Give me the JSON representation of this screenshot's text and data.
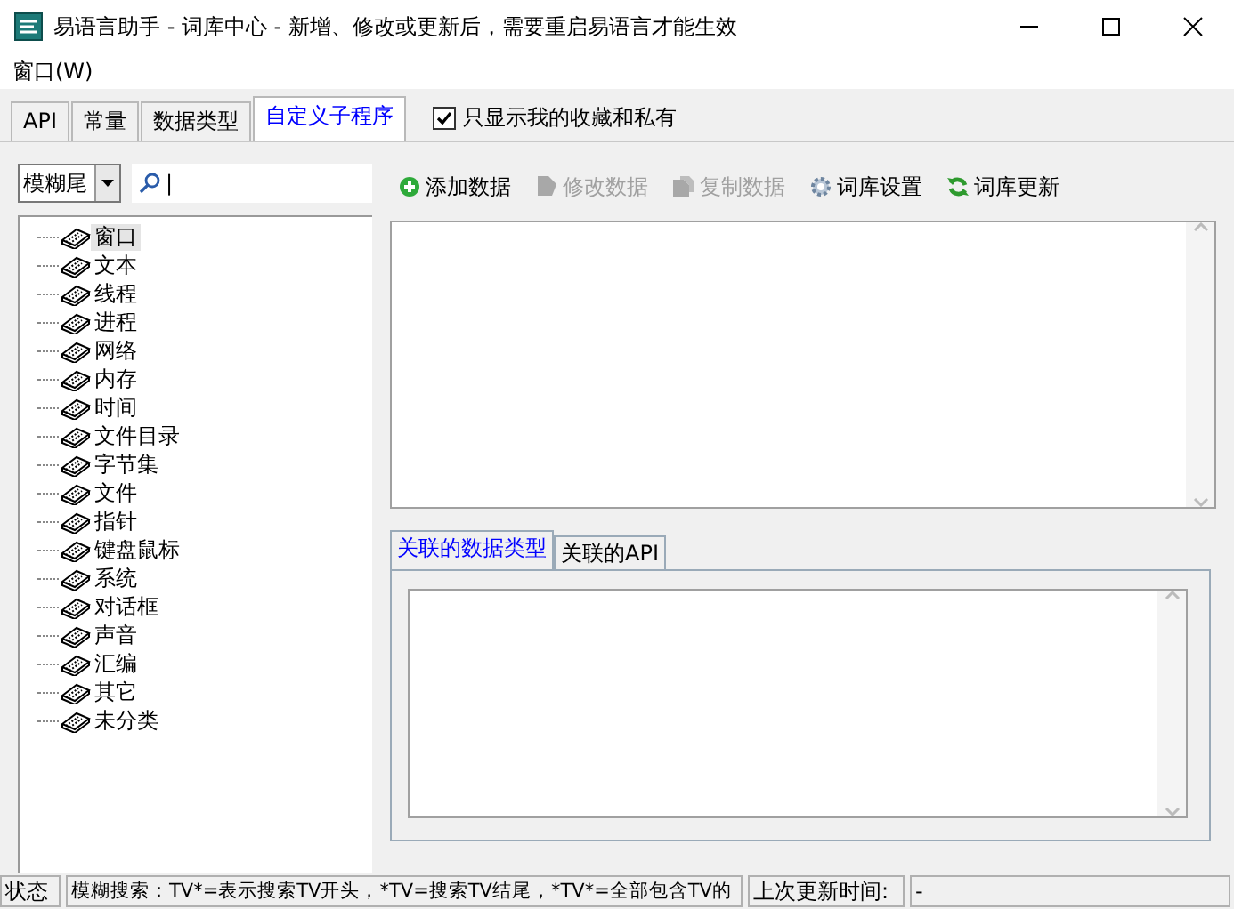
{
  "window": {
    "title": "易语言助手 - 词库中心 - 新增、修改或更新后，需要重启易语言才能生效"
  },
  "menu": [
    "窗口(W)"
  ],
  "tabs": [
    {
      "label": "API",
      "selected": false
    },
    {
      "label": "常量",
      "selected": false
    },
    {
      "label": "数据类型",
      "selected": false
    },
    {
      "label": "自定义子程序",
      "selected": true
    }
  ],
  "favorites_only": {
    "label": "只显示我的收藏和私有",
    "checked": true
  },
  "search": {
    "mode": "模糊尾",
    "value": "|"
  },
  "toolbar": [
    {
      "label": "添加数据",
      "kind": "add",
      "disabled": false
    },
    {
      "label": "修改数据",
      "kind": "edit",
      "disabled": true
    },
    {
      "label": "复制数据",
      "kind": "copy",
      "disabled": true
    },
    {
      "label": "词库设置",
      "kind": "settings",
      "disabled": false
    },
    {
      "label": "词库更新",
      "kind": "refresh",
      "disabled": false
    }
  ],
  "tree": [
    {
      "label": "窗口",
      "selected": true
    },
    {
      "label": "文本",
      "selected": false
    },
    {
      "label": "线程",
      "selected": false
    },
    {
      "label": "进程",
      "selected": false
    },
    {
      "label": "网络",
      "selected": false
    },
    {
      "label": "内存",
      "selected": false
    },
    {
      "label": "时间",
      "selected": false
    },
    {
      "label": "文件目录",
      "selected": false
    },
    {
      "label": "字节集",
      "selected": false
    },
    {
      "label": "文件",
      "selected": false
    },
    {
      "label": "指针",
      "selected": false
    },
    {
      "label": "键盘鼠标",
      "selected": false
    },
    {
      "label": "系统",
      "selected": false
    },
    {
      "label": "对话框",
      "selected": false
    },
    {
      "label": "声音",
      "selected": false
    },
    {
      "label": "汇编",
      "selected": false
    },
    {
      "label": "其它",
      "selected": false
    },
    {
      "label": "未分类",
      "selected": false
    }
  ],
  "detail_tabs": [
    {
      "label": "关联的数据类型",
      "selected": true
    },
    {
      "label": "关联的API",
      "selected": false
    }
  ],
  "status_bar": [
    "状态",
    "模糊搜索：TV*=表示搜索TV开头，*TV=搜索TV结尾，*TV*=全部包含TV的",
    "上次更新时间:",
    "-"
  ]
}
